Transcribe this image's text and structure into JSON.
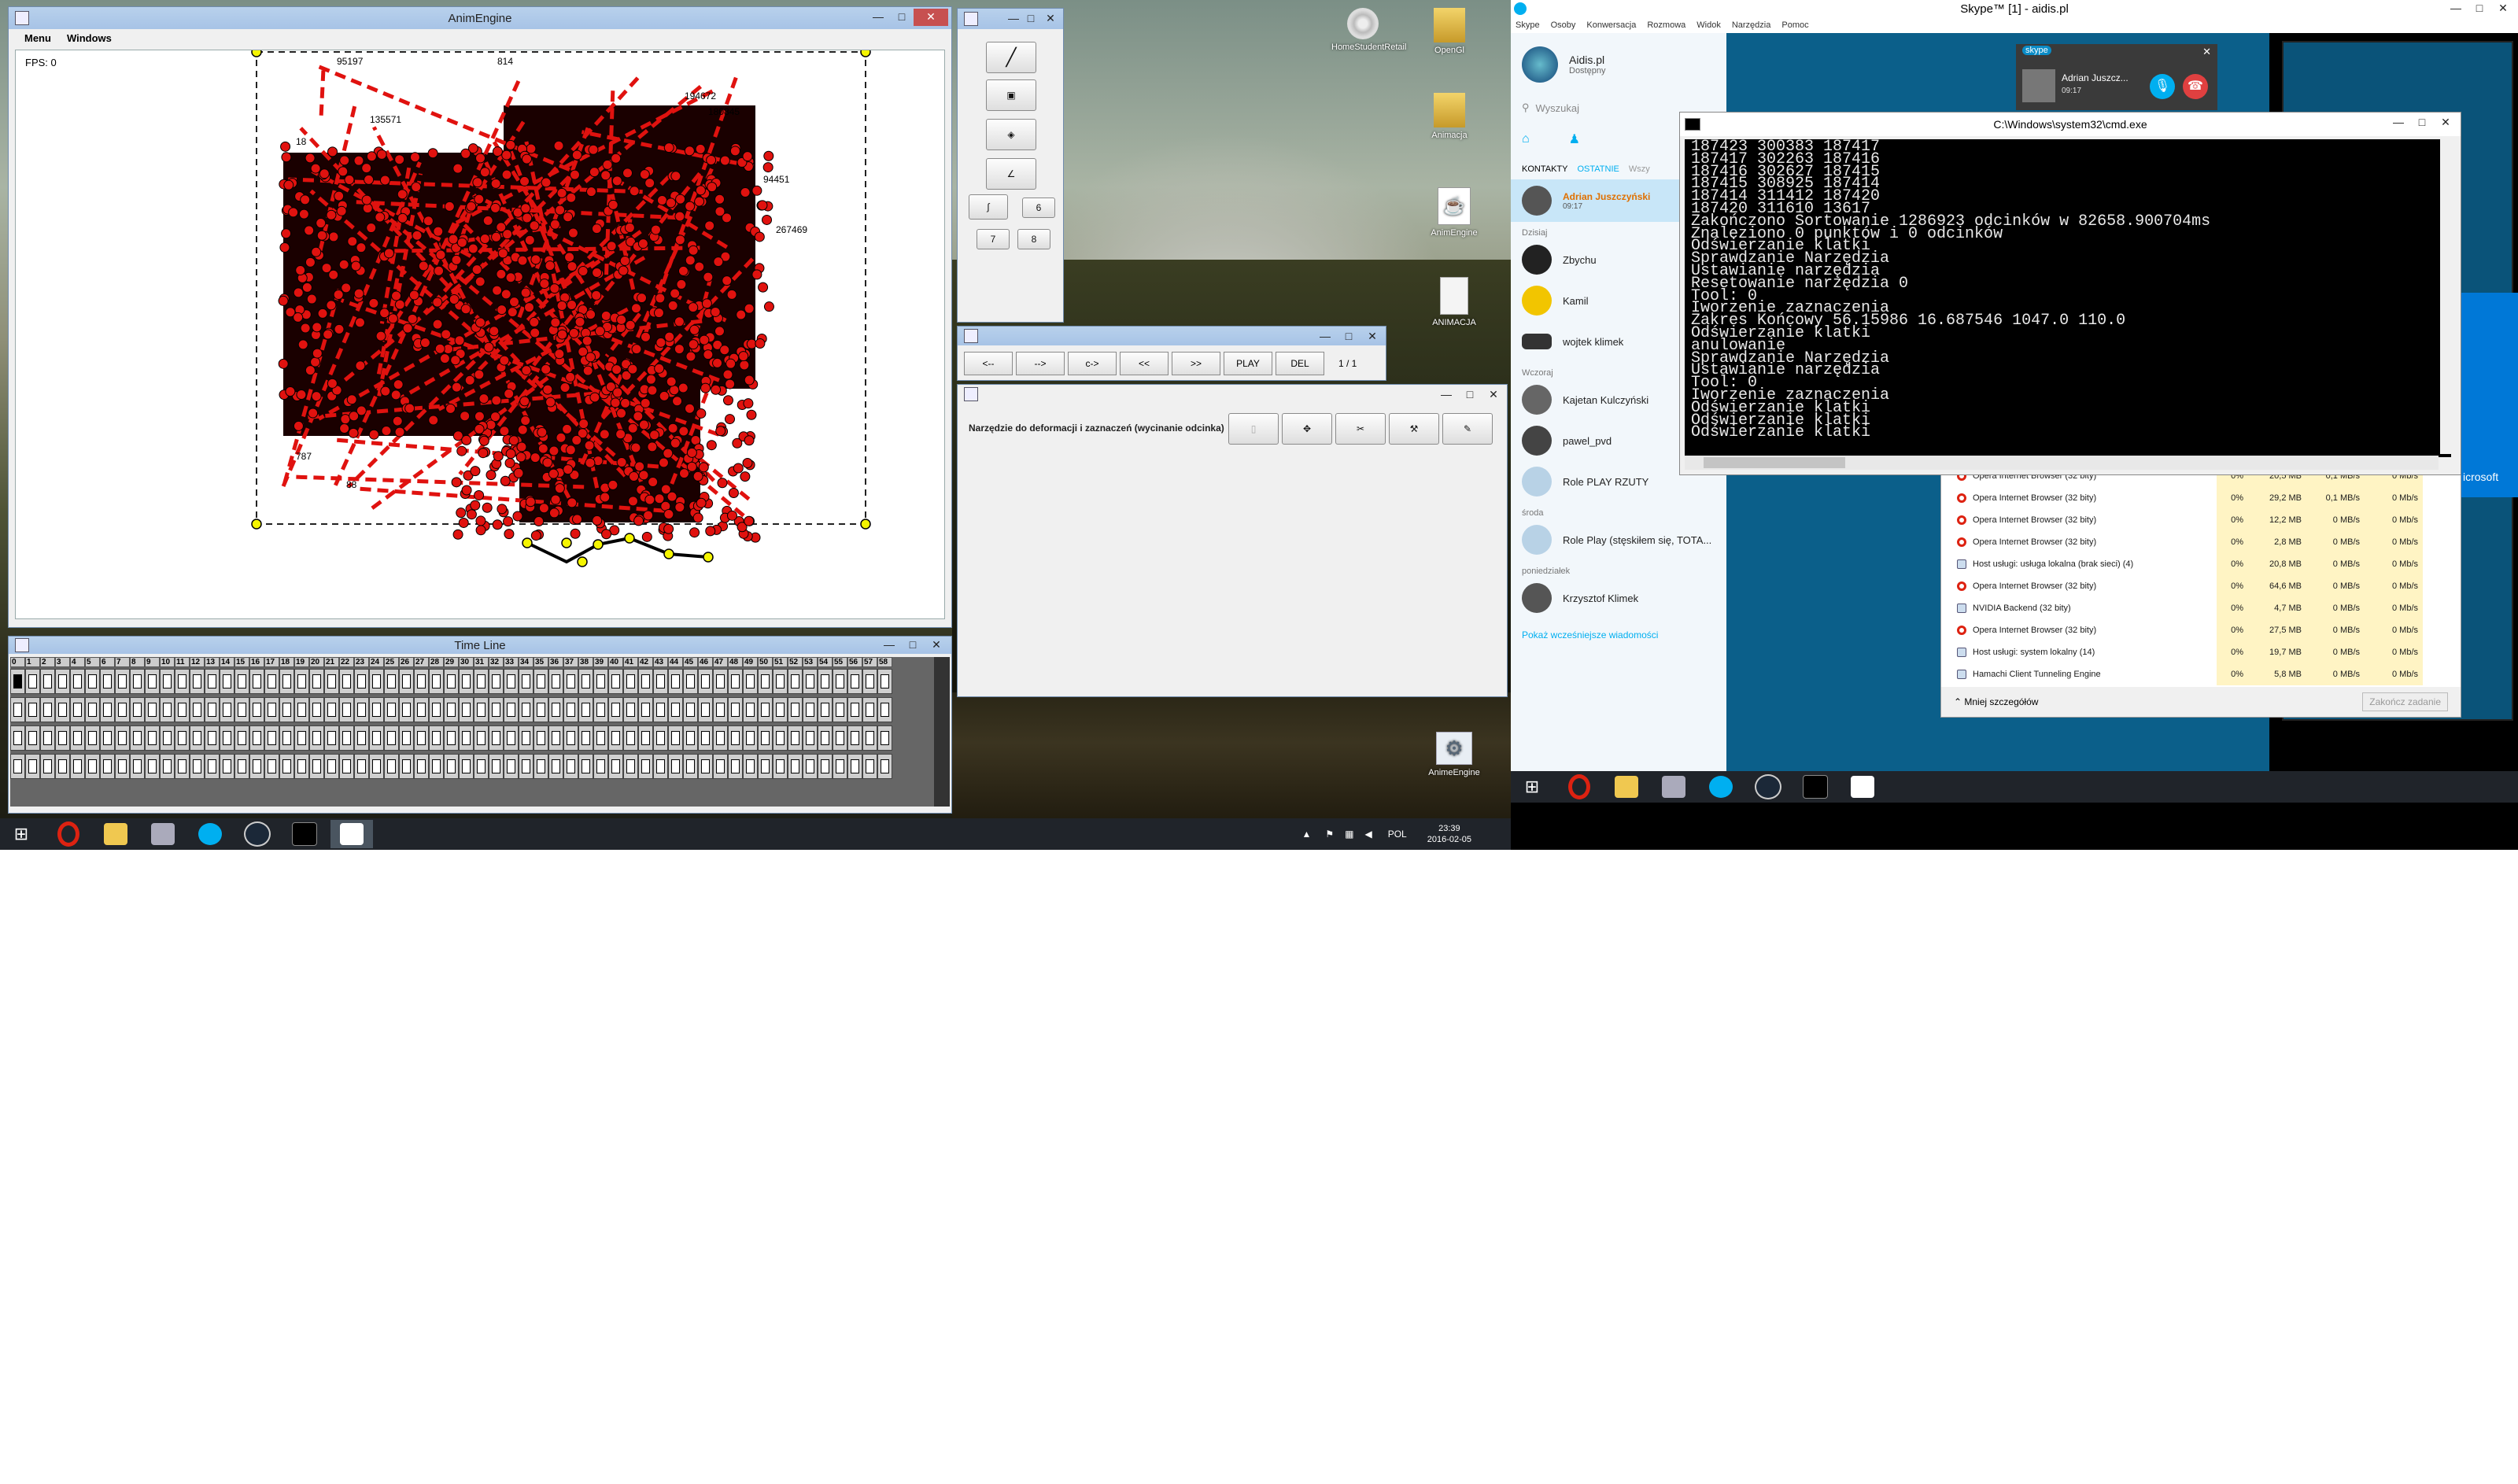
{
  "desktop_left": {
    "icons": [
      {
        "label": "HomeStudentRetail"
      },
      {
        "label": "OpenGl"
      },
      {
        "label": "Animacja"
      },
      {
        "label": "AnimEngine"
      },
      {
        "label": "ANIMACJA"
      },
      {
        "label": "AnimeEngine"
      }
    ]
  },
  "anim_window": {
    "title": "AnimEngine",
    "menu": [
      "Menu",
      "Windows"
    ],
    "fps": "FPS: 0",
    "labels": [
      "95197",
      "814",
      "194672",
      "180845",
      "135571",
      "94451",
      "267469",
      "18",
      "787",
      "88"
    ]
  },
  "tools_window": {
    "buttons": [
      "6",
      "7",
      "8"
    ]
  },
  "nav_window": {
    "buttons": [
      "<--",
      "-->",
      "c->",
      "<<",
      ">>",
      "PLAY",
      "DEL"
    ],
    "page": "1 / 1"
  },
  "deform_window": {
    "label": "Narzędzie do deformacji i zaznaczeń (wycinanie odcinka)"
  },
  "timeline": {
    "title": "Time Line",
    "frames": [
      "0",
      "1",
      "2",
      "3",
      "4",
      "5",
      "6",
      "7",
      "8",
      "9",
      "10",
      "11",
      "12",
      "13",
      "14",
      "15",
      "16",
      "17",
      "18",
      "19",
      "20",
      "21",
      "22",
      "23",
      "24",
      "25",
      "26",
      "27",
      "28",
      "29",
      "30",
      "31",
      "32",
      "33",
      "34",
      "35",
      "36",
      "37",
      "38",
      "39",
      "40",
      "41",
      "42",
      "43",
      "44",
      "45",
      "46",
      "47",
      "48",
      "49",
      "50",
      "51",
      "52",
      "53",
      "54",
      "55",
      "56",
      "57",
      "58"
    ]
  },
  "taskbar_left": {
    "lang": "POL",
    "time": "23:39",
    "date": "2016-02-05"
  },
  "skype": {
    "title": "Skype™ [1] - aidis.pl",
    "menu": [
      "Skype",
      "Osoby",
      "Konwersacja",
      "Rozmowa",
      "Widok",
      "Narzędzia",
      "Pomoc"
    ],
    "profile_name": "Aidis.pl",
    "profile_status": "Dostępny",
    "search_placeholder": "Wyszukaj",
    "tabs": [
      "KONTAKTY",
      "OSTATNIE",
      "Wszy"
    ],
    "active_contact": {
      "name": "Adrian Juszczyński",
      "time": "09:17"
    },
    "groups": [
      {
        "label": "Dzisiaj",
        "contacts": [
          "Zbychu",
          "Kamil",
          "wojtek klimek"
        ]
      },
      {
        "label": "Wczoraj",
        "contacts": [
          "Kajetan Kulczyński",
          "pawel_pvd",
          "Role PLAY RZUTY"
        ]
      },
      {
        "label": "środa",
        "contacts": [
          "Role Play (stęskiłem się, TOTA..."
        ]
      },
      {
        "label": "poniedziałek",
        "contacts": [
          "Krzysztof Klimek"
        ]
      }
    ],
    "more_link": "Pokaż wcześniejsze wiadomości",
    "call_popup": {
      "brand": "skype",
      "name": "Adrian Juszcz...",
      "time": "09:17"
    },
    "partial_text": "icrosoft"
  },
  "cmd": {
    "title": "C:\\Windows\\system32\\cmd.exe",
    "lines": [
      "187423 300383 187417",
      "187417 302263 187416",
      "187416 302627 187415",
      "187415 308925 187414",
      "187414 311412 187420",
      "187420 311610 13617",
      "Zakończono Sortowanie 1286923 odcinków w 82658.900704ms",
      "Znaleziono 0 punktów i 0 odcinków",
      "Odświerzanie klatki",
      "Sprawdzanie Narzędzia",
      "Ustawianie narzędzia",
      "Resetowanie narzędzia 0",
      "Tool: 0",
      "Iworzenie zaznaczenia",
      "Zakres Końcowy 56.15986 16.687546 1047.0 110.0",
      "Odświerzanie klatki",
      "anulowanie",
      "Sprawdzanie Narzędzia",
      "Ustawianie narzędzia",
      "Tool: 0",
      "Iworzenie zaznaczenia",
      "Odświerzanie klatki",
      "Odświerzanie klatki",
      "Odświerzanie klatki"
    ]
  },
  "task_manager": {
    "rows": [
      {
        "name": "Opera Internet Browser (32 bity)",
        "cpu": "0%",
        "mem": "20,5 MB",
        "disk": "0,1 MB/s",
        "net": "0 Mb/s"
      },
      {
        "name": "Opera Internet Browser (32 bity)",
        "cpu": "0%",
        "mem": "29,2 MB",
        "disk": "0,1 MB/s",
        "net": "0 Mb/s"
      },
      {
        "name": "Opera Internet Browser (32 bity)",
        "cpu": "0%",
        "mem": "12,2 MB",
        "disk": "0 MB/s",
        "net": "0 Mb/s"
      },
      {
        "name": "Opera Internet Browser (32 bity)",
        "cpu": "0%",
        "mem": "2,8 MB",
        "disk": "0 MB/s",
        "net": "0 Mb/s"
      },
      {
        "name": "Host usługi: usługa lokalna (brak sieci) (4)",
        "cpu": "0%",
        "mem": "20,8 MB",
        "disk": "0 MB/s",
        "net": "0 Mb/s"
      },
      {
        "name": "Opera Internet Browser (32 bity)",
        "cpu": "0%",
        "mem": "64,6 MB",
        "disk": "0 MB/s",
        "net": "0 Mb/s"
      },
      {
        "name": "NVIDIA Backend (32 bity)",
        "cpu": "0%",
        "mem": "4,7 MB",
        "disk": "0 MB/s",
        "net": "0 Mb/s"
      },
      {
        "name": "Opera Internet Browser (32 bity)",
        "cpu": "0%",
        "mem": "27,5 MB",
        "disk": "0 MB/s",
        "net": "0 Mb/s"
      },
      {
        "name": "Host usługi: system lokalny (14)",
        "cpu": "0%",
        "mem": "19,7 MB",
        "disk": "0 MB/s",
        "net": "0 Mb/s"
      },
      {
        "name": "Hamachi Client Tunneling Engine",
        "cpu": "0%",
        "mem": "5,8 MB",
        "disk": "0 MB/s",
        "net": "0 Mb/s"
      }
    ],
    "less_details": "Mniej szczegółów",
    "end_task": "Zakończ zadanie"
  },
  "colors": {
    "dot_red": "#e0120f",
    "selection_yellow": "#f5f500",
    "skype_blue": "#00aff0",
    "win_title": "#a7c3e6"
  }
}
